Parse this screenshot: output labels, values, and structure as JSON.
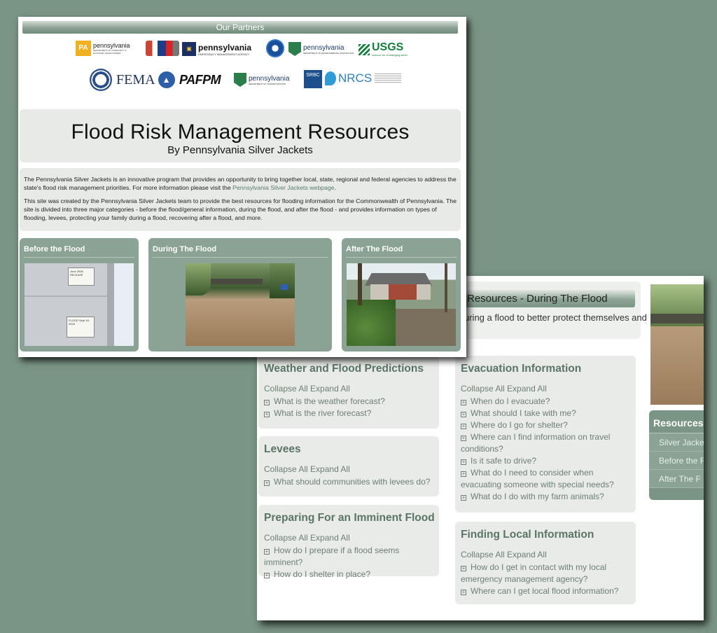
{
  "front": {
    "partners_title": "Our Partners",
    "logos": [
      {
        "name": "pa-dced-logo",
        "text": "pennsylvania",
        "sub": "DEPARTMENT OF COMMUNITY & ECONOMIC DEVELOPMENT"
      },
      {
        "name": "pa-shields-logo",
        "text": ""
      },
      {
        "name": "pema-logo",
        "text": "pennsylvania",
        "sub": "EMERGENCY MANAGEMENT AGENCY"
      },
      {
        "name": "noaa-logo",
        "text": ""
      },
      {
        "name": "pa-dep-logo",
        "text": "pennsylvania",
        "sub": "DEPARTMENT OF ENVIRONMENTAL PROTECTION"
      },
      {
        "name": "usgs-logo",
        "text": "USGS",
        "sub": "science for a changing world"
      },
      {
        "name": "dhs-seal-logo",
        "text": ""
      },
      {
        "name": "fema-logo",
        "text": "FEMA"
      },
      {
        "name": "pafpm-logo",
        "text": "PAFPM"
      },
      {
        "name": "penndot-logo",
        "text": "pennsylvania",
        "sub": "DEPARTMENT OF TRANSPORTATION"
      },
      {
        "name": "srbc-logo",
        "text": "SRBC"
      },
      {
        "name": "nrcs-logo",
        "text": "NRCS"
      }
    ],
    "title": "Flood Risk Management Resources",
    "subtitle": "By Pennsylvania Silver Jackets",
    "intro_p1_a": "The Pennsylvania Silver Jackets is an innovative program that provides an opportunity to bring together local, state, regional and federal agencies to address the state's flood risk management priorities. For more information please visit the ",
    "intro_p1_link": "Pennsylvania Silver Jackets webpage",
    "intro_p1_b": ".",
    "intro_p2": "This site was created by the Pennsylvania Silver Jackets team to provide the best resources for flooding information for the Commonwealth of Pennsylvania. The site is divided into three major categories - before the flood/general information, during the flood, and after the flood - and provides information on types of flooding, levees, protecting your family during a flood, recovering after a flood, and more.",
    "sections": [
      {
        "title": "Before the Flood",
        "marks": [
          "June 2006 RELEASE",
          "FLOOD Sept 18, 2004"
        ]
      },
      {
        "title": "During The Flood"
      },
      {
        "title": "After The Flood"
      }
    ]
  },
  "back": {
    "header_title": "Resources - During The Flood",
    "header_text": "uring a flood to better protect themselves and",
    "collapse_label": "Collapse All",
    "expand_label": "Expand All",
    "cards": [
      {
        "title": "Weather and Flood Predictions",
        "items": [
          "What is the weather forecast?",
          "What is the river forecast?"
        ]
      },
      {
        "title": "Levees",
        "items": [
          "What should communities with levees do?"
        ]
      },
      {
        "title": "Preparing For an Imminent Flood",
        "items": [
          "How do I prepare if a flood seems imminent?",
          "How do I shelter in place?"
        ]
      },
      {
        "title": "Evacuation Information",
        "items": [
          "When do I evacuate?",
          "What should I take with me?",
          "Where do I go for shelter?",
          "Where can I find information on travel conditions?",
          "Is it safe to drive?",
          "What do I need to consider when evacuating someone with special needs?",
          "What do I do with my farm animals?"
        ]
      },
      {
        "title": "Finding Local Information",
        "items": [
          "How do I get in contact with my local emergency management agency?",
          "Where can I get local flood information?"
        ]
      }
    ],
    "resources_title": "Resources",
    "resources_items": [
      "Silver Jacke",
      "Before the F",
      "After The F"
    ]
  },
  "colors": {
    "accent": "#7a9585",
    "card": "#8aa395",
    "heading": "#5a7566"
  }
}
